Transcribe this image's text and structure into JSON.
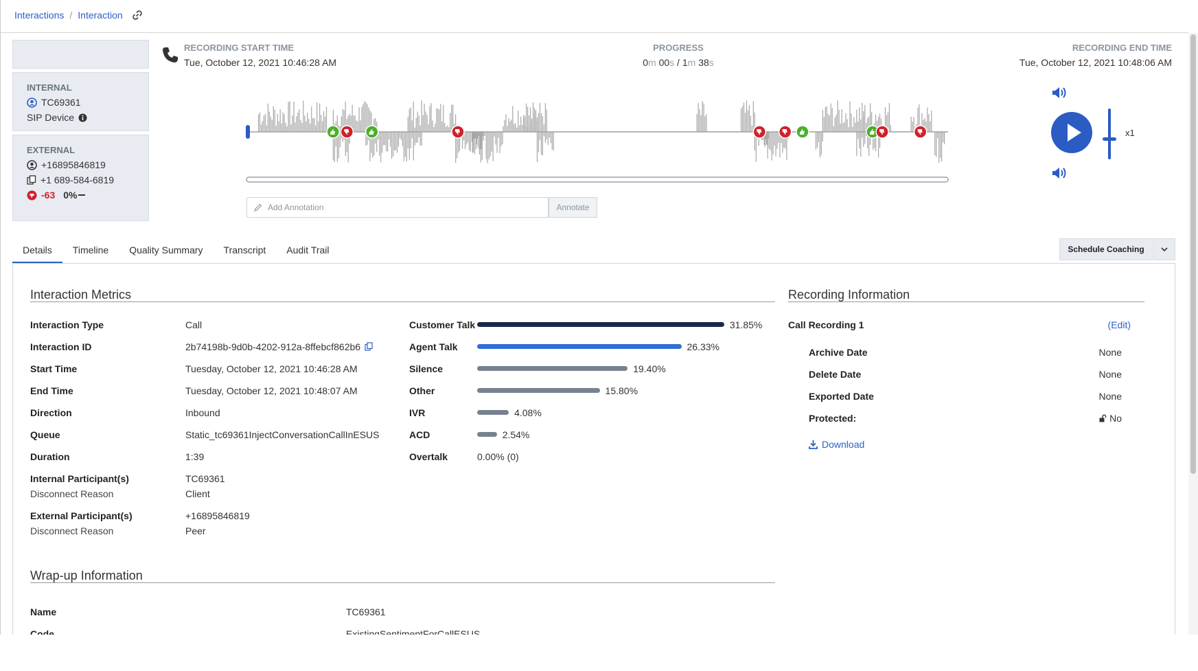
{
  "breadcrumb": {
    "root": "Interactions",
    "separator": "/",
    "current": "Interaction"
  },
  "internal": {
    "header": "INTERNAL",
    "user": "TC69361",
    "device": "SIP Device"
  },
  "external": {
    "header": "EXTERNAL",
    "user": "+16895846819",
    "phone": "+1 689-584-6819",
    "sentiment": "-63",
    "percent": "0%"
  },
  "recording": {
    "start_label": "RECORDING START TIME",
    "start_value": "Tue, October 12, 2021 10:46:28 AM",
    "progress_label": "PROGRESS",
    "progress": {
      "cur_m": "0",
      "cur_s": "00",
      "tot_m": "1",
      "tot_s": "38",
      "m": "m",
      "s": "s",
      "sep": " / "
    },
    "end_label": "RECORDING END TIME",
    "end_value": "Tue, October 12, 2021 10:48:06 AM",
    "speed": "x1",
    "progress_fraction": 0
  },
  "annotation": {
    "placeholder": "Add Annotation",
    "button": "Annotate"
  },
  "tabs": [
    "Details",
    "Timeline",
    "Quality Summary",
    "Transcript",
    "Audit Trail"
  ],
  "coaching": {
    "button": "Schedule Coaching"
  },
  "metrics": {
    "title": "Interaction Metrics",
    "rows": [
      {
        "label": "Interaction Type",
        "value": "Call"
      },
      {
        "label": "Interaction ID",
        "value": "2b74198b-9d0b-4202-912a-8ffebcf862b6"
      },
      {
        "label": "Start Time",
        "value": "Tuesday, October 12, 2021 10:46:28 AM"
      },
      {
        "label": "End Time",
        "value": "Tuesday, October 12, 2021 10:48:07 AM"
      },
      {
        "label": "Direction",
        "value": "Inbound"
      },
      {
        "label": "Queue",
        "value": "Static_tc69361InjectConversationCallInESUS"
      },
      {
        "label": "Duration",
        "value": "1:39"
      },
      {
        "label": "Internal Participant(s)",
        "value": "TC69361",
        "sub_label": "Disconnect Reason",
        "sub_value": "Client"
      },
      {
        "label": "External Participant(s)",
        "value": "+16895846819",
        "sub_label": "Disconnect Reason",
        "sub_value": "Peer"
      }
    ],
    "bars": [
      {
        "label": "Customer Talk",
        "percent": "31.85%",
        "value": 31.85,
        "color": "#1b2a4a"
      },
      {
        "label": "Agent Talk",
        "percent": "26.33%",
        "value": 26.33,
        "color": "#2f6fd6"
      },
      {
        "label": "Silence",
        "percent": "19.40%",
        "value": 19.4,
        "color": "#77828e"
      },
      {
        "label": "Other",
        "percent": "15.80%",
        "value": 15.8,
        "color": "#77828e"
      },
      {
        "label": "IVR",
        "percent": "4.08%",
        "value": 4.08,
        "color": "#77828e"
      },
      {
        "label": "ACD",
        "percent": "2.54%",
        "value": 2.54,
        "color": "#77828e"
      }
    ],
    "overtalk": {
      "label": "Overtalk",
      "value": "0.00% (0)"
    }
  },
  "recording_info": {
    "title": "Recording Information",
    "name": "Call Recording 1",
    "edit": "(Edit)",
    "rows": [
      {
        "label": "Archive Date",
        "value": "None"
      },
      {
        "label": "Delete Date",
        "value": "None"
      },
      {
        "label": "Exported Date",
        "value": "None"
      },
      {
        "label": "Protected:",
        "value": "No"
      }
    ],
    "download": "Download"
  },
  "wrapup": {
    "title": "Wrap-up Information",
    "rows": [
      {
        "label": "Name",
        "value": "TC69361"
      },
      {
        "label": "Code",
        "value": "ExistingSentimentForCallESUS"
      }
    ]
  },
  "colors": {
    "accent": "#2a60c8",
    "positive": "#4caf2a",
    "negative": "#d0212b"
  },
  "sentiment_markers": [
    {
      "type": "positive",
      "time": 0.118
    },
    {
      "type": "negative",
      "time": 0.138
    },
    {
      "type": "positive",
      "time": 0.174
    },
    {
      "type": "negative",
      "time": 0.298
    },
    {
      "type": "negative",
      "time": 0.733
    },
    {
      "type": "negative",
      "time": 0.77
    },
    {
      "type": "positive",
      "time": 0.795
    },
    {
      "type": "positive",
      "time": 0.896
    },
    {
      "type": "negative",
      "time": 0.91
    },
    {
      "type": "negative",
      "time": 0.965
    }
  ]
}
